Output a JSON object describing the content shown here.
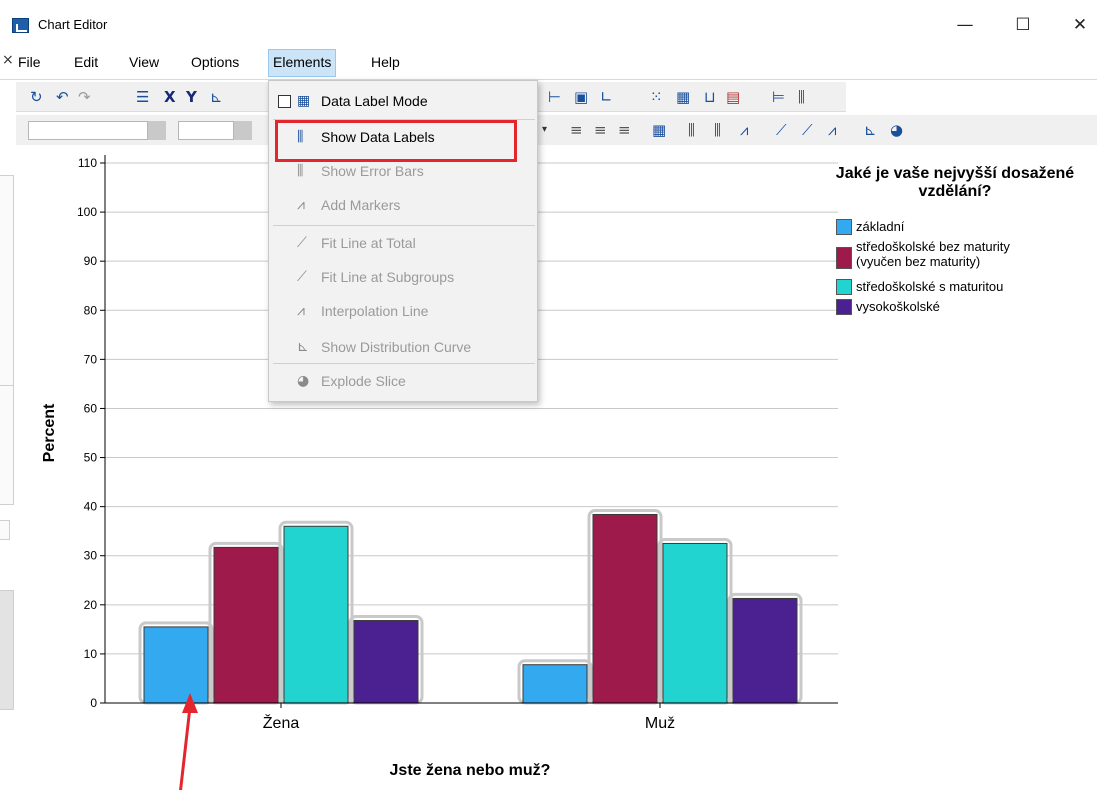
{
  "window": {
    "title": "Chart Editor",
    "minimize": "—",
    "maximize": "☐",
    "close": "✕"
  },
  "menubar": {
    "items": [
      "File",
      "Edit",
      "View",
      "Options",
      "Elements",
      "Help"
    ],
    "active": "Elements"
  },
  "dropdown": {
    "items": [
      {
        "label": "Data Label Mode",
        "state": "enabled",
        "icon": "data-label-mode-icon"
      },
      {
        "label": "Show Data Labels",
        "state": "enabled",
        "icon": "show-data-labels-icon"
      },
      {
        "label": "Show Error Bars",
        "state": "disabled",
        "icon": "error-bars-icon"
      },
      {
        "label": "Add Markers",
        "state": "disabled",
        "icon": "markers-icon"
      },
      {
        "label": "Fit Line at Total",
        "state": "disabled",
        "icon": "fit-line-total-icon"
      },
      {
        "label": "Fit Line at Subgroups",
        "state": "disabled",
        "icon": "fit-line-subgroups-icon"
      },
      {
        "label": "Interpolation Line",
        "state": "disabled",
        "icon": "interpolation-line-icon"
      },
      {
        "label": "Show Distribution Curve",
        "state": "disabled",
        "icon": "distribution-curve-icon"
      },
      {
        "label": "Explode Slice",
        "state": "disabled",
        "icon": "explode-slice-icon"
      }
    ]
  },
  "legend": {
    "title": "Jaké je vaše nejvyšší dosažené vzdělání?",
    "entries": [
      {
        "label": "základní",
        "color": "#33aaf0"
      },
      {
        "label": "středoškolské bez maturity (vyučen bez maturity)",
        "color": "#9e1a4a"
      },
      {
        "label": "středoškolské s maturitou",
        "color": "#22d4d0"
      },
      {
        "label": "vysokoškolské",
        "color": "#4b2191"
      }
    ]
  },
  "chart_data": {
    "type": "bar",
    "categories": [
      "Žena",
      "Muž"
    ],
    "series": [
      {
        "name": "základní",
        "values": [
          15.5,
          7.8
        ],
        "color": "#33aaf0"
      },
      {
        "name": "středoškolské bez maturity (vyučen bez maturity)",
        "values": [
          31.7,
          38.4
        ],
        "color": "#9e1a4a"
      },
      {
        "name": "středoškolské s maturitou",
        "values": [
          36.0,
          32.5
        ],
        "color": "#22d4d0"
      },
      {
        "name": "vysokoškolské",
        "values": [
          16.8,
          21.3
        ],
        "color": "#4b2191"
      }
    ],
    "xlabel": "Jste žena nebo muž?",
    "ylabel": "Percent",
    "ylim": [
      0,
      110
    ],
    "yticks": [
      0,
      10,
      20,
      30,
      40,
      50,
      60,
      70,
      80,
      90,
      100,
      110
    ],
    "grid": true,
    "legend_position": "right"
  }
}
